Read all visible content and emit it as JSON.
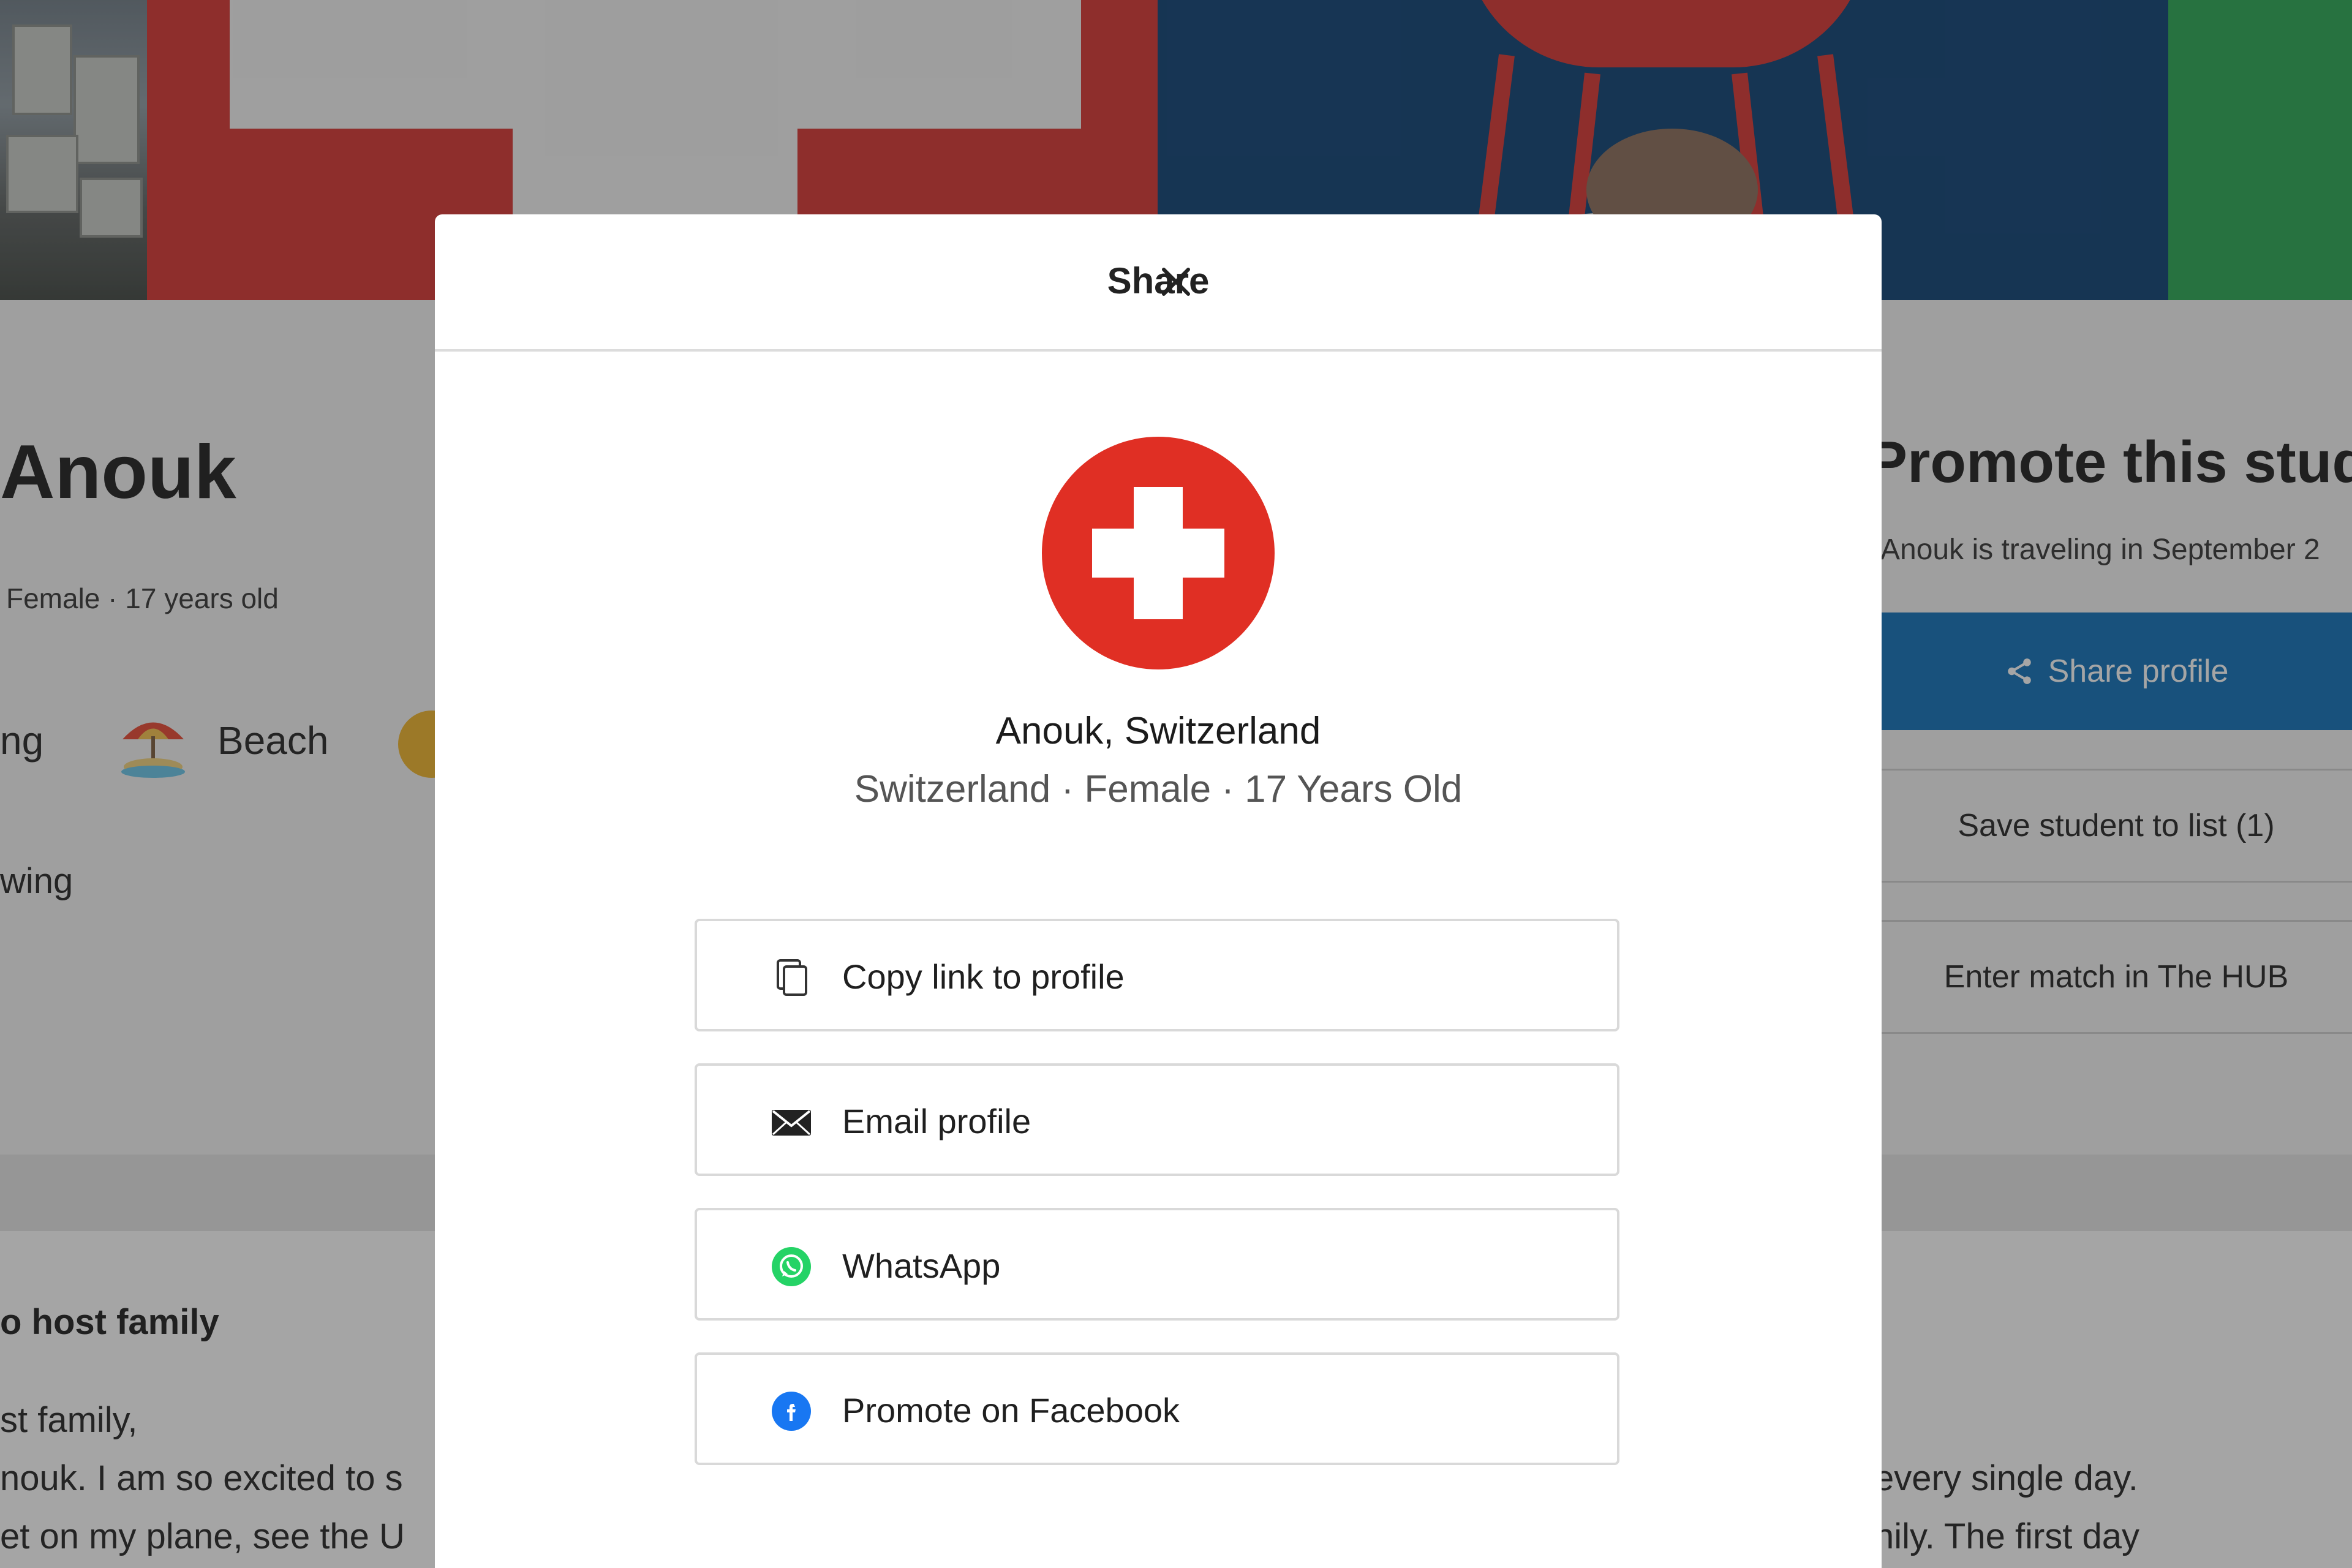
{
  "background": {
    "student": {
      "name": "Anouk",
      "meta": "Female · 17 years old"
    },
    "interests": {
      "partial_label": "ng",
      "beach_label": "Beach"
    },
    "partial_label_wing": "wing",
    "about": {
      "title": "o host family",
      "left_lines": [
        "st family,",
        "nouk. I am so excited to s",
        "et on my plane, see the U"
      ],
      "right_lines": [
        "every single day.",
        "nily. The first day"
      ]
    },
    "promote": {
      "title": "Promote this stude",
      "subtitle": "Anouk is traveling in September 2",
      "share_profile_label": "Share profile",
      "save_label": "Save student to list (1)",
      "match_label": "Enter match in The HUB"
    }
  },
  "modal": {
    "title": "Share",
    "student_name": "Anouk, Switzerland",
    "student_meta": "Switzerland · Female · 17 Years Old",
    "options": [
      {
        "label": "Copy link to profile",
        "icon": "copy-icon"
      },
      {
        "label": "Email profile",
        "icon": "envelope-icon"
      },
      {
        "label": "WhatsApp",
        "icon": "whatsapp-icon"
      },
      {
        "label": "Promote on Facebook",
        "icon": "facebook-icon"
      }
    ]
  },
  "colors": {
    "share_button": "#0d6fb8",
    "swiss_red": "#e02f24",
    "whatsapp_green": "#25d366",
    "facebook_blue": "#1877f2"
  }
}
